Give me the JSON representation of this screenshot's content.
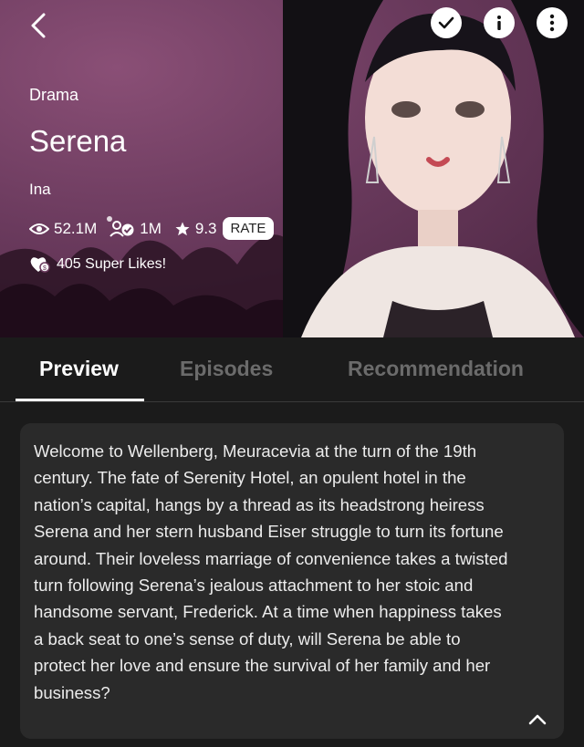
{
  "header": {
    "back_icon": "chevron-left-icon",
    "actions": [
      {
        "name": "subscribed-check-icon",
        "icon": "checkmark"
      },
      {
        "name": "info-icon",
        "icon": "info"
      },
      {
        "name": "more-icon",
        "icon": "vertical-dots"
      }
    ]
  },
  "series": {
    "genre": "Drama",
    "title": "Serena",
    "author": "Ina",
    "views": "52.1M",
    "subscribers": "1M",
    "rating": "9.3",
    "rate_label": "RATE",
    "super_likes": "405 Super Likes!"
  },
  "tabs": [
    {
      "label": "Preview",
      "active": true
    },
    {
      "label": "Episodes",
      "active": false
    },
    {
      "label": "Recommendation",
      "active": false
    }
  ],
  "description": "Welcome to Wellenberg, Meuracevia at the turn of the 19th century. The fate of Serenity Hotel, an opulent hotel in the nation’s capital, hangs by a thread as its headstrong heiress Serena and her stern husband Eiser struggle to turn its fortune around. Their loveless marriage of convenience takes a twisted turn following Serena’s jealous attachment to her stoic and handsome servant, Frederick. At a time when happiness takes a back seat to one’s sense of duty, will Serena be able to protect her love and ensure the survival of her family and her business?",
  "colors": {
    "hero_background": "#6a3a5d",
    "page_background": "#1b1b1b",
    "card_background": "#2a2a2a",
    "tab_inactive": "#6b6b6b"
  }
}
